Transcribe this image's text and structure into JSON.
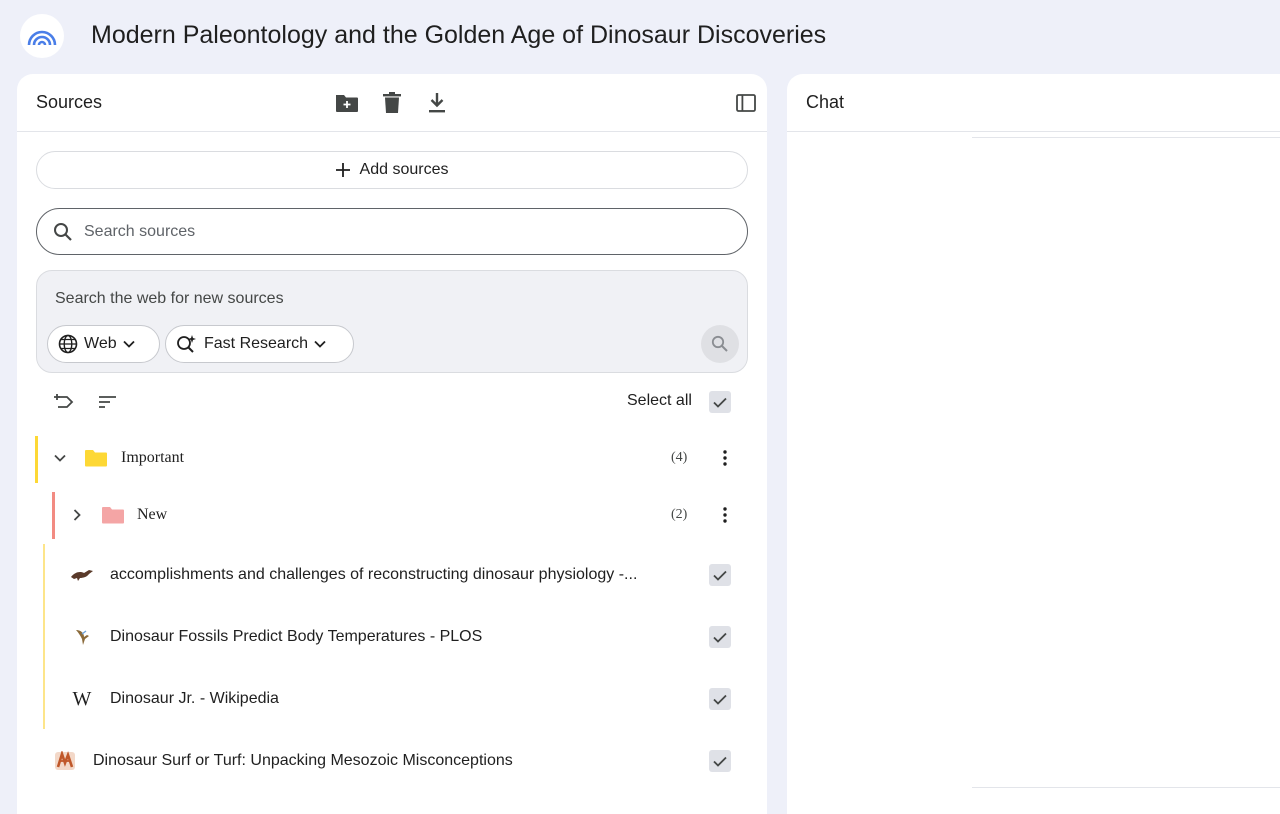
{
  "header": {
    "title": "Modern Paleontology and the Golden Age of Dinosaur Discoveries",
    "logo_icon": "notebooklm-logo-icon"
  },
  "sources": {
    "title": "Sources",
    "toolbar_icons": [
      "new-folder-icon",
      "delete-icon",
      "download-icon",
      "collapse-panel-icon"
    ],
    "add_label": "Add sources",
    "search_placeholder": "Search sources",
    "web_hint": "Search the web for new sources",
    "web_chip": "Web",
    "research_chip": "Fast Research",
    "select_all": "Select all",
    "folders": [
      {
        "name": "Important",
        "count": "(4)",
        "color": "#fdd835",
        "bar": "#fdd835",
        "expanded": true
      },
      {
        "name": "New",
        "count": "(2)",
        "color": "#f4a5a5",
        "bar": "#f28b82",
        "expanded": false
      }
    ],
    "items": [
      {
        "title": "accomplishments and challenges of reconstructing dinosaur physiology -...",
        "icon": "dinosaur-icon",
        "checked": true
      },
      {
        "title": "Dinosaur Fossils Predict Body Temperatures - PLOS",
        "icon": "plos-bird-icon",
        "checked": true
      },
      {
        "title": "Dinosaur Jr. - Wikipedia",
        "icon": "wikipedia-icon",
        "icon_text": "W",
        "checked": true
      },
      {
        "title": "Dinosaur Surf or Turf: Unpacking Mesozoic Misconceptions",
        "icon": "fossil-icon",
        "checked": true
      }
    ]
  },
  "chat": {
    "title": "Chat"
  },
  "colors": {
    "background": "#eef0f9",
    "panel": "#ffffff",
    "checkbox": "#dfe1e7"
  }
}
